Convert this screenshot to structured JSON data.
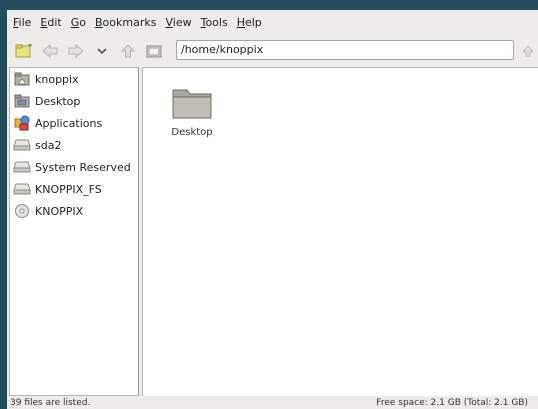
{
  "menubar": {
    "items": [
      {
        "mnemonic": "F",
        "rest": "ile"
      },
      {
        "mnemonic": "E",
        "rest": "dit"
      },
      {
        "mnemonic": "G",
        "rest": "o"
      },
      {
        "mnemonic": "B",
        "rest": "ookmarks"
      },
      {
        "mnemonic": "V",
        "rest": "iew"
      },
      {
        "mnemonic": "T",
        "rest": "ools"
      },
      {
        "mnemonic": "H",
        "rest": "elp"
      }
    ]
  },
  "toolbar": {
    "location": "/home/knoppix",
    "icons": [
      "new-tab-icon",
      "back-icon",
      "forward-icon",
      "history-dropdown-icon",
      "up-icon",
      "home-icon"
    ]
  },
  "sidebar": {
    "items": [
      {
        "label": "knoppix",
        "icon": "home-folder-icon"
      },
      {
        "label": "Desktop",
        "icon": "desktop-icon"
      },
      {
        "label": "Applications",
        "icon": "applications-icon"
      },
      {
        "label": "sda2",
        "icon": "drive-icon"
      },
      {
        "label": "System Reserved",
        "icon": "drive-icon"
      },
      {
        "label": "KNOPPIX_FS",
        "icon": "drive-icon"
      },
      {
        "label": "KNOPPIX",
        "icon": "cdrom-icon"
      }
    ]
  },
  "main": {
    "files": [
      {
        "name": "Desktop",
        "icon": "folder-icon"
      }
    ]
  },
  "status": {
    "left": "39 files are listed.",
    "right": "Free space: 2.1 GB (Total: 2.1 GB)"
  },
  "colors": {
    "desktop_bg": "#234f5c",
    "window_bg": "#edeceb",
    "content_bg": "#ffffff"
  }
}
